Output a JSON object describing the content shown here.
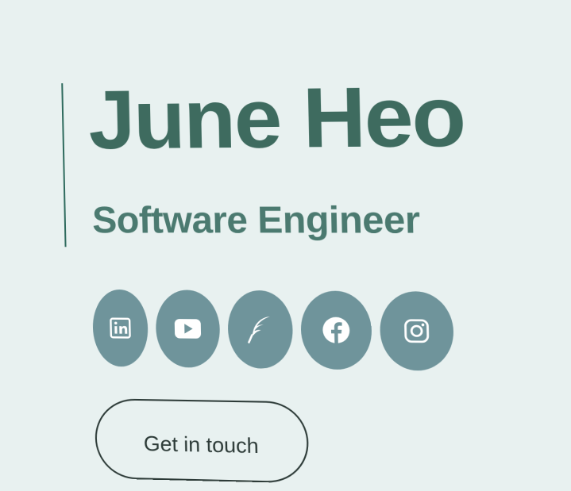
{
  "profile": {
    "name": "June Heo",
    "role": "Software Engineer"
  },
  "socials": [
    {
      "icon": "linkedin-icon"
    },
    {
      "icon": "youtube-icon"
    },
    {
      "icon": "feather-icon"
    },
    {
      "icon": "facebook-icon"
    },
    {
      "icon": "instagram-icon"
    }
  ],
  "cta": {
    "label": "Get in touch"
  },
  "colors": {
    "background": "#e8f1f0",
    "accent": "#2f6b5e",
    "name_text": "#3e6b5f",
    "role_text": "#4b7a70",
    "social_bg": "#6f949b",
    "icon_fg": "#ffffff"
  }
}
